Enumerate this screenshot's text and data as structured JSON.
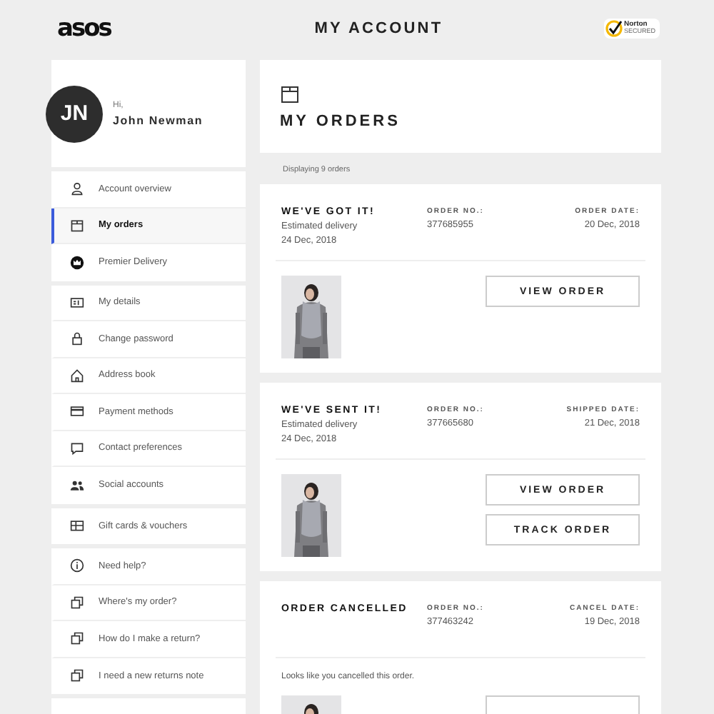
{
  "header": {
    "logo": "asos",
    "title": "MY ACCOUNT",
    "badge": {
      "name": "Norton",
      "sub": "SECURED"
    }
  },
  "profile": {
    "initials": "JN",
    "greeting": "Hi,",
    "name": "John Newman"
  },
  "nav_groups": [
    [
      {
        "kind": "user",
        "label": "Account overview",
        "selected": false
      },
      {
        "kind": "box",
        "label": "My orders",
        "selected": true
      },
      {
        "kind": "crown",
        "label": "Premier Delivery",
        "selected": false
      }
    ],
    [
      {
        "kind": "id",
        "label": "My details",
        "selected": false
      },
      {
        "kind": "lock",
        "label": "Change password",
        "selected": false
      },
      {
        "kind": "home",
        "label": "Address book",
        "selected": false
      },
      {
        "kind": "card",
        "label": "Payment methods",
        "selected": false
      },
      {
        "kind": "chat",
        "label": "Contact preferences",
        "selected": false
      },
      {
        "kind": "people",
        "label": "Social accounts",
        "selected": false
      }
    ],
    [
      {
        "kind": "gift",
        "label": "Gift cards & vouchers",
        "selected": false
      }
    ],
    [
      {
        "kind": "info",
        "label": "Need help?",
        "selected": false
      },
      {
        "kind": "copy",
        "label": "Where's my order?",
        "selected": false
      },
      {
        "kind": "copy",
        "label": "How do I make a return?",
        "selected": false
      },
      {
        "kind": "copy",
        "label": "I need a new returns note",
        "selected": false
      }
    ]
  ],
  "page": {
    "title": "MY ORDERS",
    "count": "Displaying 9 orders"
  },
  "orders": [
    {
      "kind": "delivery",
      "status": "WE'VE GOT IT!",
      "note": "Estimated delivery",
      "note_date": "24 Dec, 2018",
      "number_label": "ORDER NO.:",
      "number": "377685955",
      "date_label": "ORDER DATE:",
      "date": "20 Dec, 2018",
      "buttons": [
        "VIEW ORDER"
      ]
    },
    {
      "kind": "delivery",
      "status": "WE'VE SENT IT!",
      "note": "Estimated delivery",
      "note_date": "24 Dec, 2018",
      "number_label": "ORDER NO.:",
      "number": "377665680",
      "date_label": "SHIPPED DATE:",
      "date": "21 Dec, 2018",
      "buttons": [
        "VIEW ORDER",
        "TRACK ORDER"
      ]
    },
    {
      "kind": "cancelled",
      "status": "ORDER CANCELLED",
      "message": "Looks like you cancelled this order.",
      "number_label": "ORDER NO.:",
      "number": "377463242",
      "date_label": "CANCEL DATE:",
      "date": "19 Dec, 2018"
    }
  ]
}
